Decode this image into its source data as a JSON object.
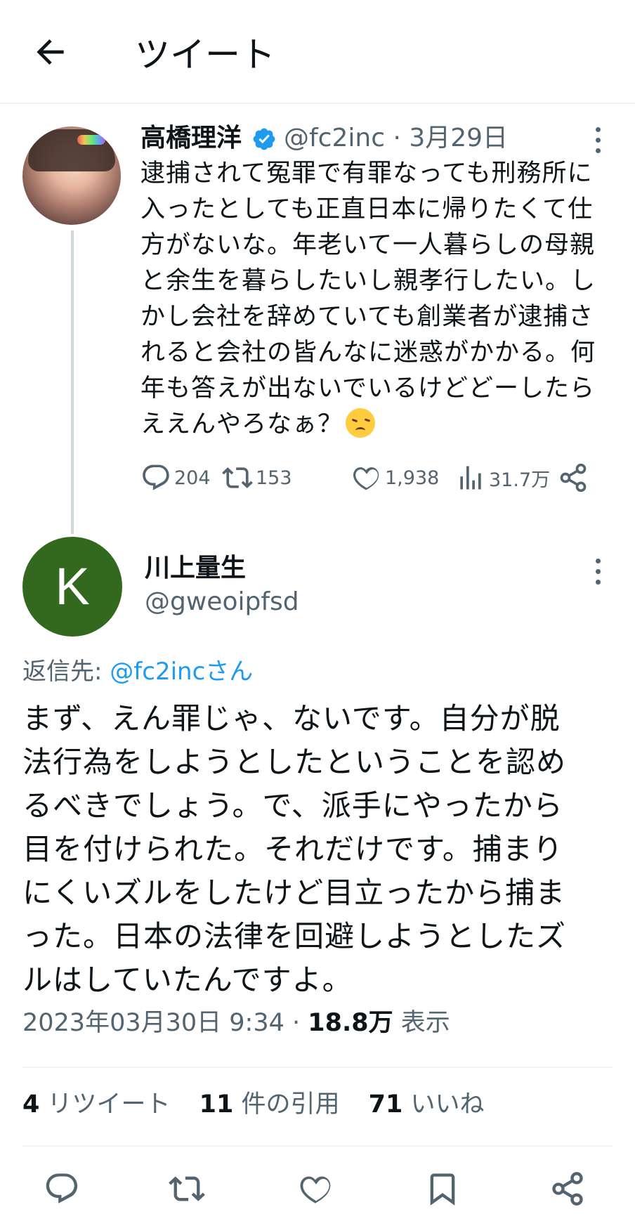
{
  "header": {
    "title": "ツイート",
    "back_icon": "arrow-left-icon"
  },
  "parent_tweet": {
    "author_name": "高橋理洋",
    "verified": true,
    "handle": "@fc2inc",
    "date": "3月29日",
    "lines": [
      "逮捕されて冤罪で有罪なっても刑務所に",
      "入ったとしても正直日本に帰りたくて仕",
      "方がないな。年老いて一人暮らしの母親",
      "と余生を暮らしたいし親孝行したい。し",
      "かし会社を辞めていても創業者が逮捕さ",
      "れると会社の皆んなに迷惑がかかる。何",
      "年も答えが出ないでいるけどどーしたら",
      "ええんやろなぁ？"
    ],
    "emoji": "disappointed-face-emoji",
    "replies": "204",
    "retweets": "153",
    "likes": "1,938",
    "views": "31.7万"
  },
  "reply_tweet": {
    "avatar_letter": "K",
    "author_name": "川上量生",
    "handle": "@gweoipfsd",
    "reply_to_label": "返信先:",
    "reply_to_mention": "@fc2incさん",
    "lines": [
      "まず、えん罪じゃ、ないです。自分が脱",
      "法行為をしようとしたということを認め",
      "るべきでしょう。で、派手にやったから",
      "目を付けられた。それだけです。捕まり",
      "にくいズルをしたけど目立ったから捕ま",
      "った。日本の法律を回避しようとしたズ",
      "ルはしていたんですよ。"
    ],
    "timestamp": "2023年03月30日 9:34",
    "separator": "·",
    "views_count": "18.8万",
    "views_label": "表示",
    "stats": {
      "retweets_count": "4",
      "retweets_label": "リツイート",
      "quotes_count": "11",
      "quotes_label": "件の引用",
      "likes_count": "71",
      "likes_label": "いいね"
    }
  },
  "colors": {
    "accent": "#1d9bf0",
    "muted": "#536471",
    "avatar_green": "#33691e"
  }
}
